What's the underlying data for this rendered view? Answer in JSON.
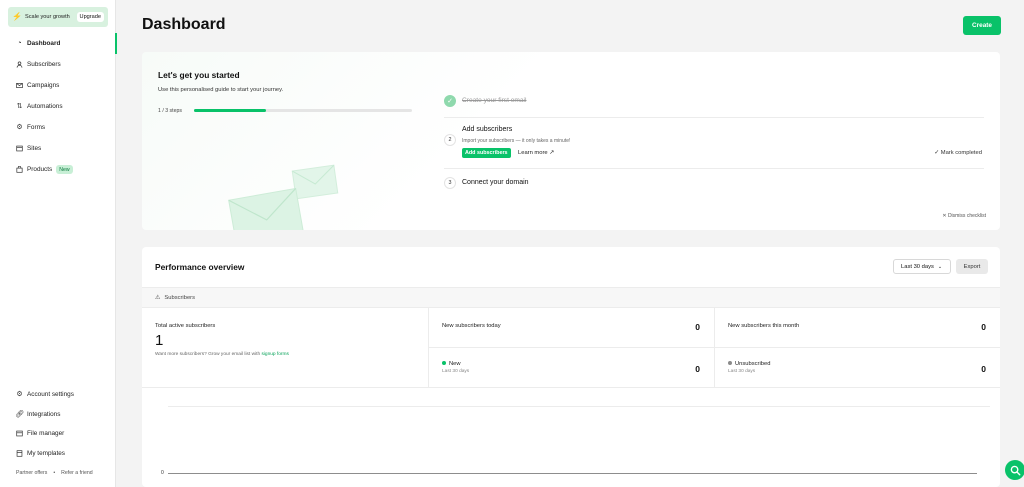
{
  "promo": {
    "text": "Scale your growth",
    "upgrade_label": "Upgrade"
  },
  "sidebar": {
    "items": [
      {
        "label": "Dashboard",
        "icon": "dashboard-icon"
      },
      {
        "label": "Subscribers",
        "icon": "user-icon"
      },
      {
        "label": "Campaigns",
        "icon": "mail-icon"
      },
      {
        "label": "Automations",
        "icon": "automation-icon"
      },
      {
        "label": "Forms",
        "icon": "forms-icon"
      },
      {
        "label": "Sites",
        "icon": "sites-icon"
      },
      {
        "label": "Products",
        "icon": "products-icon",
        "badge": "New"
      }
    ],
    "bottom_items": [
      {
        "label": "Account settings",
        "icon": "gear-icon"
      },
      {
        "label": "Integrations",
        "icon": "link-icon"
      },
      {
        "label": "File manager",
        "icon": "file-icon"
      },
      {
        "label": "My templates",
        "icon": "template-icon"
      }
    ],
    "footer": {
      "partner_offers": "Partner offers",
      "separator": "•",
      "refer_friend": "Refer a friend"
    }
  },
  "header": {
    "title": "Dashboard",
    "create_label": "Create"
  },
  "getting_started": {
    "title": "Let's get you started",
    "subtitle": "Use this personalised guide to start your journey.",
    "steps_label": "1 / 3 steps",
    "progress": 0.33,
    "steps": [
      {
        "number": "1",
        "title": "Create your first email",
        "done": true
      },
      {
        "number": "2",
        "title": "Add subscribers",
        "description": "Import your subscribers — it only takes a minute!",
        "primary_action": "Add subscribers",
        "secondary_action": "Learn more ↗",
        "mark_completed": "Mark completed"
      },
      {
        "number": "3",
        "title": "Connect your domain"
      }
    ],
    "dismiss_label": "Dismiss checklist"
  },
  "performance": {
    "title": "Performance overview",
    "range": "Last 30 days",
    "export_label": "Export",
    "section_label": "Subscribers",
    "total": {
      "label": "Total active subscribers",
      "value": "1",
      "more_text": "Want more subscribers? Grow your email list with",
      "more_link": "signup forms"
    },
    "cells": [
      {
        "label": "New subscribers today",
        "value": "0"
      },
      {
        "label": "New subscribers this month",
        "value": "0"
      },
      {
        "label": "New",
        "sublabel": "Last 30 days",
        "value": "0",
        "dot_color": "#09c269"
      },
      {
        "label": "Unsubscribed",
        "sublabel": "Last 30 days",
        "value": "0",
        "dot_color": "#8a8a8a"
      }
    ],
    "chart_zero_label": "0"
  },
  "colors": {
    "accent": "#09c269"
  }
}
